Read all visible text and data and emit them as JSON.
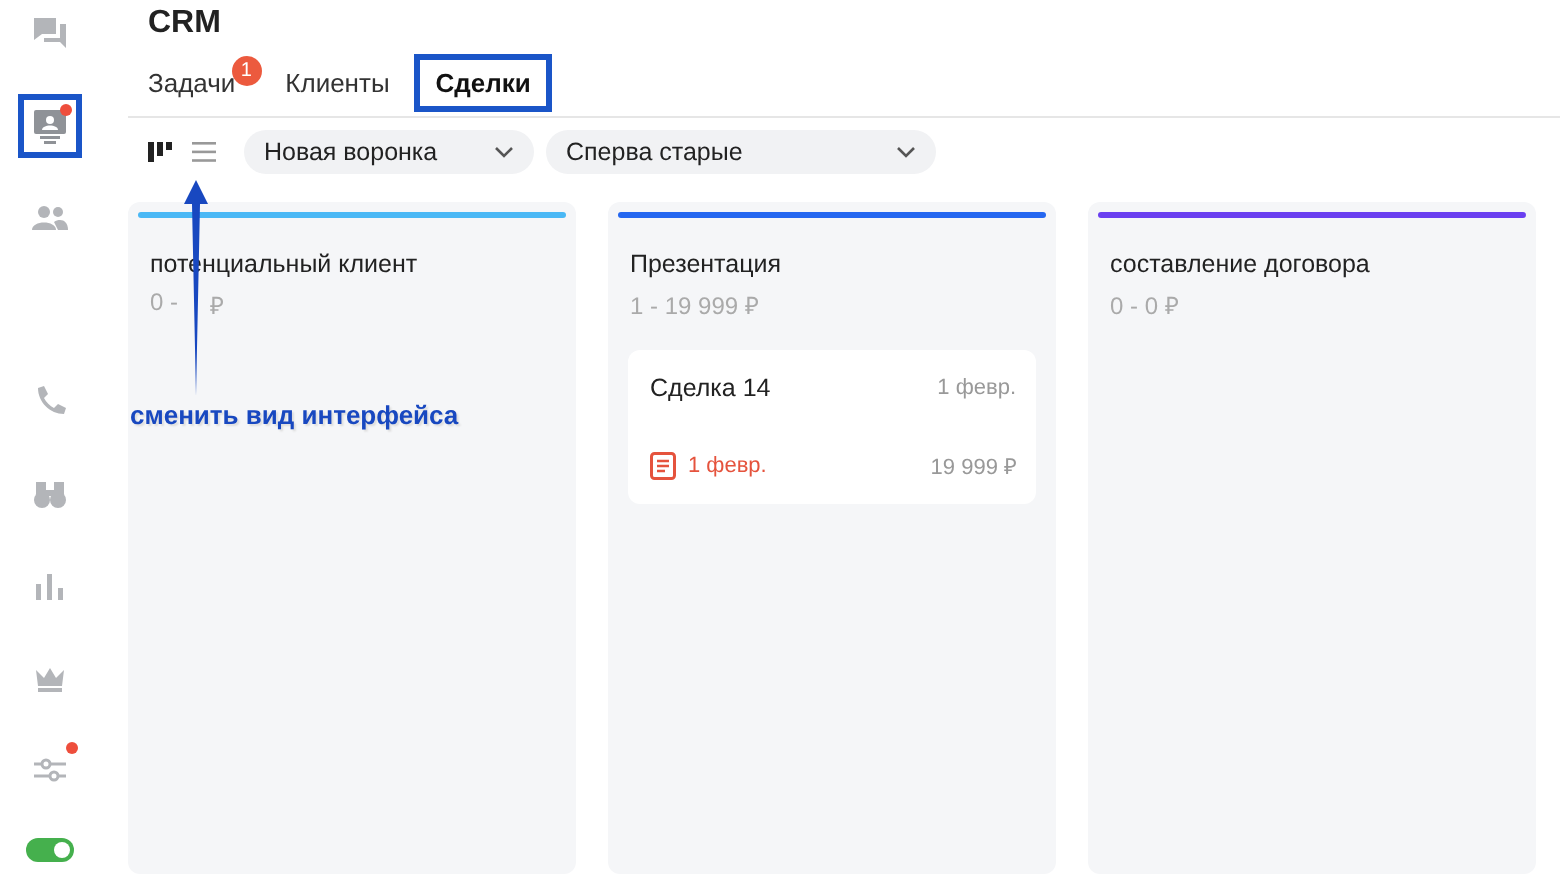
{
  "sidebar": {
    "items": [
      {
        "kind": "chat",
        "selected": false,
        "dot": false
      },
      {
        "kind": "contact",
        "selected": true,
        "dot": true
      },
      {
        "kind": "people",
        "selected": false,
        "dot": false
      },
      {
        "kind": "phone",
        "selected": false,
        "dot": false
      },
      {
        "kind": "binoculars",
        "selected": false,
        "dot": false
      },
      {
        "kind": "chart",
        "selected": false,
        "dot": false
      },
      {
        "kind": "crown",
        "selected": false,
        "dot": false
      },
      {
        "kind": "sliders",
        "selected": false,
        "dot": true
      }
    ],
    "toggle": {
      "on": true
    }
  },
  "header": {
    "title": "CRM"
  },
  "tabs": [
    {
      "label": "Задачи",
      "badge": "1",
      "selected": false
    },
    {
      "label": "Клиенты",
      "selected": false
    },
    {
      "label": "Сделки",
      "selected": true
    }
  ],
  "toolbar": {
    "views": [
      {
        "kind": "kanban",
        "selected": true
      },
      {
        "kind": "list",
        "selected": false
      }
    ],
    "funnel": {
      "value": "Новая воронка"
    },
    "sort": {
      "value": "Сперва старые"
    }
  },
  "columns": [
    {
      "title": "потенциальный клиент",
      "summary": "0 -",
      "summary_end": "₽",
      "color": "#4ab8f5"
    },
    {
      "title": "Презентация",
      "summary": "1 - 19 999 ₽",
      "color": "#2567f0",
      "deals": [
        {
          "name": "Сделка 14",
          "date": "1 февр.",
          "task_date": "1 февр.",
          "amount": "19 999 ₽"
        }
      ]
    },
    {
      "title": "составление договора",
      "summary": "0 - 0 ₽",
      "color": "#6a3ff0"
    }
  ],
  "annotation": {
    "text": "сменить вид интерфейса"
  }
}
